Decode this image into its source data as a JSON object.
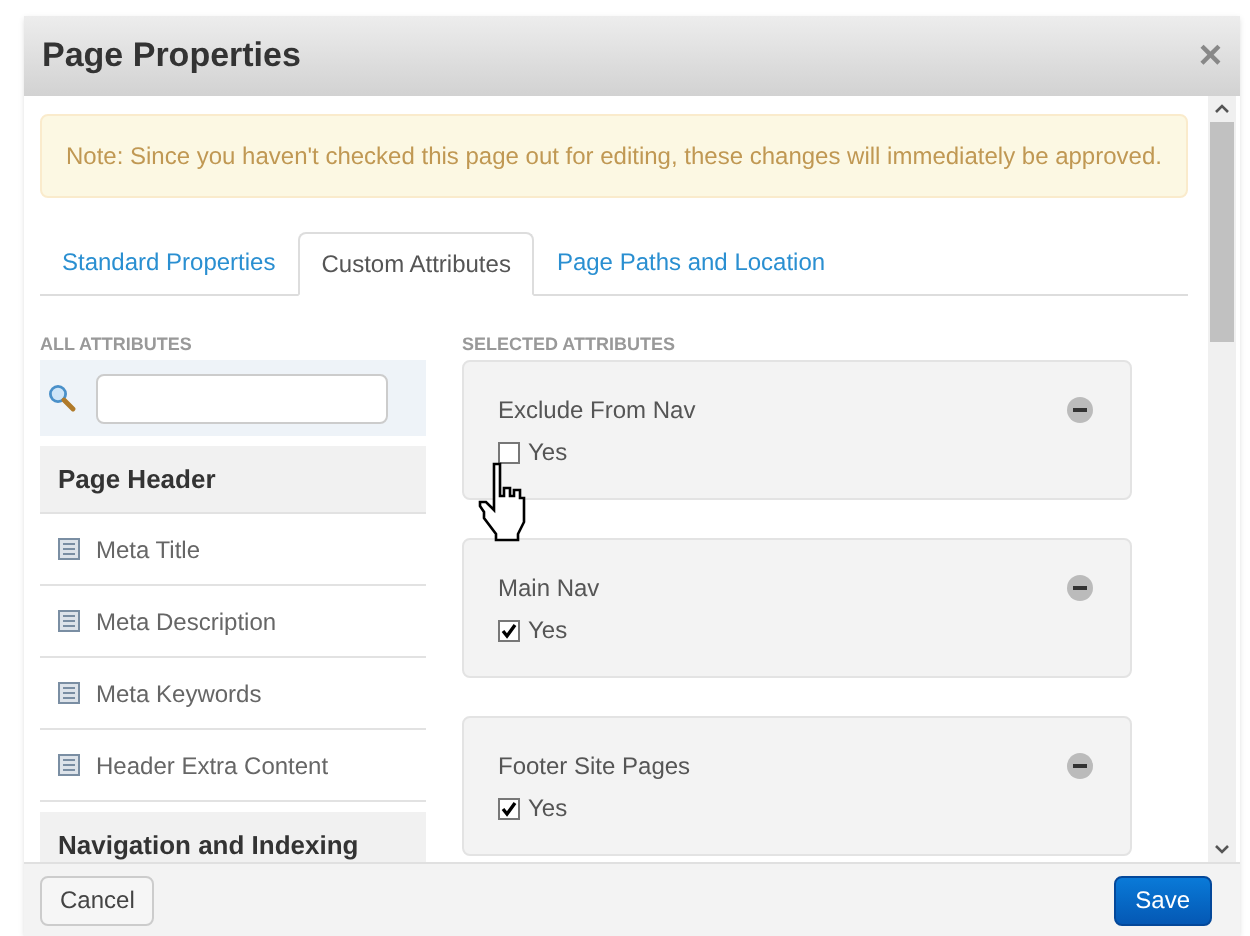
{
  "window": {
    "title": "Page Properties",
    "close": "×"
  },
  "notice": "Note: Since you haven't checked this page out for editing, these changes will immediately be approved.",
  "tabs": [
    {
      "label": "Standard Properties",
      "selected": false
    },
    {
      "label": "Custom Attributes",
      "selected": true
    },
    {
      "label": "Page Paths and Location",
      "selected": false
    }
  ],
  "all_attributes": {
    "heading": "ALL ATTRIBUTES",
    "items": [
      {
        "kind": "group",
        "label": "Page Header"
      },
      {
        "kind": "attribute",
        "label": "Meta Title"
      },
      {
        "kind": "attribute",
        "label": "Meta Description"
      },
      {
        "kind": "attribute",
        "label": "Meta Keywords"
      },
      {
        "kind": "attribute",
        "label": "Header Extra Content"
      },
      {
        "kind": "group",
        "label": "Navigation and Indexing"
      }
    ]
  },
  "selected_attributes": {
    "heading": "SELECTED ATTRIBUTES",
    "items": [
      {
        "label": "Exclude From Nav",
        "option": "Yes",
        "checked": false
      },
      {
        "label": "Main Nav",
        "option": "Yes",
        "checked": true
      },
      {
        "label": "Footer Site Pages",
        "option": "Yes",
        "checked": true
      }
    ]
  },
  "buttons": [
    {
      "label": "Cancel",
      "kind": "secondary"
    },
    {
      "label": "Save",
      "kind": "primary"
    }
  ]
}
